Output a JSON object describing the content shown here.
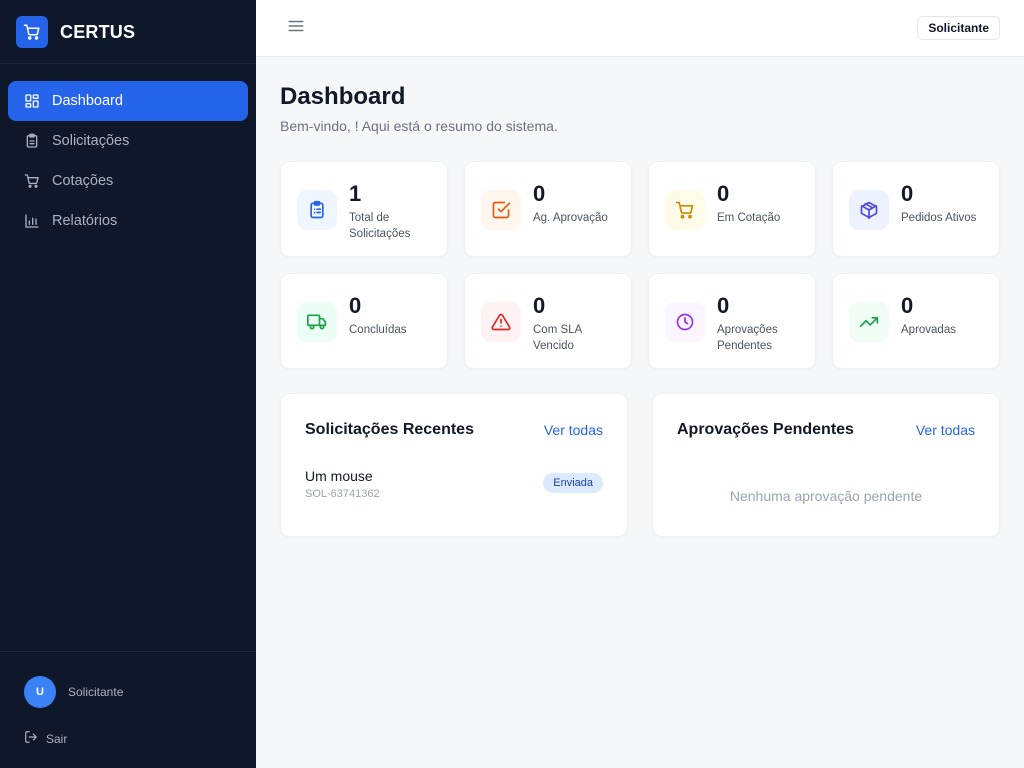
{
  "app": {
    "name": "CERTUS"
  },
  "sidebar": {
    "items": [
      {
        "label": "Dashboard",
        "icon": "dashboard-icon",
        "active": true
      },
      {
        "label": "Solicitações",
        "icon": "clipboard-icon"
      },
      {
        "label": "Cotações",
        "icon": "cart-icon"
      },
      {
        "label": "Relatórios",
        "icon": "bar-chart-icon"
      }
    ],
    "user": {
      "initial": "U",
      "name": "Solicitante"
    },
    "logout_label": "Sair"
  },
  "topbar": {
    "role": "Solicitante"
  },
  "page": {
    "title": "Dashboard",
    "subtitle": "Bem-vindo, ! Aqui está o resumo do sistema."
  },
  "stats": [
    {
      "value": "1",
      "label": "Total de Solicitações",
      "icon": "clipboard-list-icon",
      "color": "#2563eb",
      "bg": "#eff6ff"
    },
    {
      "value": "0",
      "label": "Ag. Aprovação",
      "icon": "check-square-icon",
      "color": "#ea580c",
      "bg": "#fff7ed"
    },
    {
      "value": "0",
      "label": "Em Cotação",
      "icon": "cart-icon",
      "color": "#ca8a04",
      "bg": "#fefce8"
    },
    {
      "value": "0",
      "label": "Pedidos Ativos",
      "icon": "package-icon",
      "color": "#4f46e5",
      "bg": "#eef2ff"
    },
    {
      "value": "0",
      "label": "Concluídas",
      "icon": "truck-icon",
      "color": "#16a34a",
      "bg": "#ecfdf5"
    },
    {
      "value": "0",
      "label": "Com SLA Vencido",
      "icon": "alert-triangle-icon",
      "color": "#dc2626",
      "bg": "#fef2f2"
    },
    {
      "value": "0",
      "label": "Aprovações Pendentes",
      "icon": "clock-icon",
      "color": "#9333ea",
      "bg": "#faf5ff"
    },
    {
      "value": "0",
      "label": "Aprovadas",
      "icon": "trending-up-icon",
      "color": "#16a34a",
      "bg": "#f0fdf4"
    }
  ],
  "recent_requests": {
    "title": "Solicitações Recentes",
    "link": "Ver todas",
    "items": [
      {
        "title": "Um mouse",
        "code": "SOL-63741362",
        "status": "Enviada"
      }
    ]
  },
  "pending_approvals": {
    "title": "Aprovações Pendentes",
    "link": "Ver todas",
    "empty": "Nenhuma aprovação pendente"
  }
}
